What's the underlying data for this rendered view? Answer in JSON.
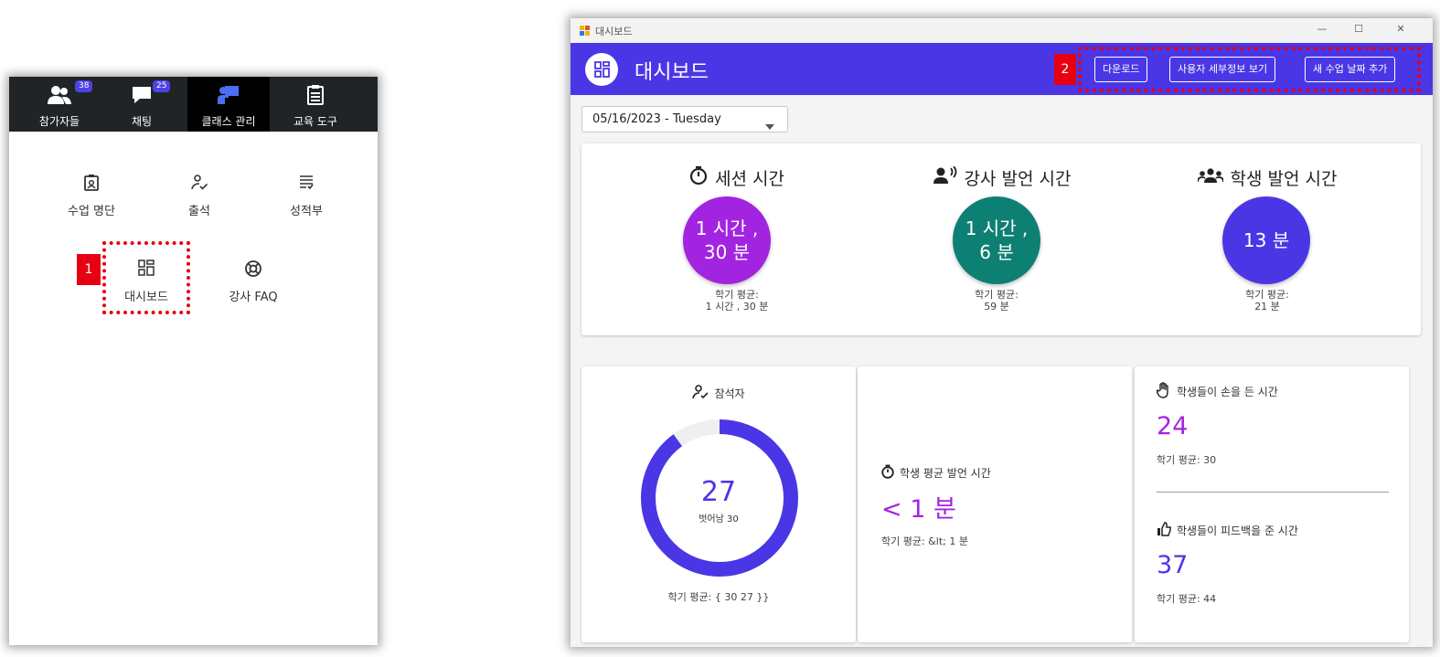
{
  "left_panel": {
    "tabs": [
      {
        "label": "참가자들",
        "badge": "38",
        "icon": "participants-icon"
      },
      {
        "label": "채팅",
        "badge": "25",
        "icon": "chat-icon"
      },
      {
        "label": "클래스 관리",
        "badge": "",
        "icon": "class-management-icon"
      },
      {
        "label": "교육 도구",
        "badge": "",
        "icon": "education-tools-icon"
      }
    ],
    "grid": [
      {
        "label": "수업 명단",
        "icon": "roster-icon"
      },
      {
        "label": "출석",
        "icon": "attendance-icon"
      },
      {
        "label": "성적부",
        "icon": "gradebook-icon"
      },
      {
        "label": "대시보드",
        "icon": "dashboard-icon"
      },
      {
        "label": "강사 FAQ",
        "icon": "faq-lifebuoy-icon"
      }
    ],
    "marker": "1"
  },
  "window": {
    "title": "대시보드",
    "controls": [
      "—",
      "☐",
      "✕"
    ],
    "header": {
      "title": "대시보드",
      "marker": "2",
      "buttons": [
        "다운로드",
        "사용자 세부정보 보기",
        "새 수업 날짜 추가"
      ]
    },
    "date_select": {
      "value": "05/16/2023 - Tuesday"
    },
    "stats": [
      {
        "title": "세션 시간",
        "value_line1": "1 시간 ,",
        "value_line2": "30 분",
        "avg_label": "학기 평균:",
        "avg_value": "1 시간 , 30 분",
        "color": "#a324e0",
        "icon": "timer-icon"
      },
      {
        "title": "강사 발언 시간",
        "value_line1": "1 시간 ,",
        "value_line2": "6 분",
        "avg_label": "학기 평균:",
        "avg_value": "59 분",
        "color": "#0e7f73",
        "icon": "speaker-icon"
      },
      {
        "title": "학생 발언 시간",
        "value_line1": "13 분",
        "value_line2": "",
        "avg_label": "학기 평균:",
        "avg_value": "21 분",
        "color": "#4b36e6",
        "icon": "students-group-icon"
      }
    ],
    "attendees": {
      "title": "참석자",
      "count": "27",
      "away_label": "벗어남 30",
      "avg": "학기 평균: { 30 27 }}",
      "fraction": 0.9,
      "color": "#4b36e6",
      "track_color": "#efefef"
    },
    "student_speaking": {
      "title": "학생 평균 발언 시간",
      "value": "< 1 분",
      "avg": "학기 평균: &lt; 1 분",
      "color": "#a324e0"
    },
    "raised_hands": {
      "title": "학생들이 손을 든 시간",
      "value": "24",
      "avg": "학기 평균: 30",
      "color": "#a324e0"
    },
    "feedback": {
      "title": "학생들이 피드백을 준 시간",
      "value": "37",
      "avg": "학기 평균: 44",
      "color": "#4b36e6"
    }
  }
}
